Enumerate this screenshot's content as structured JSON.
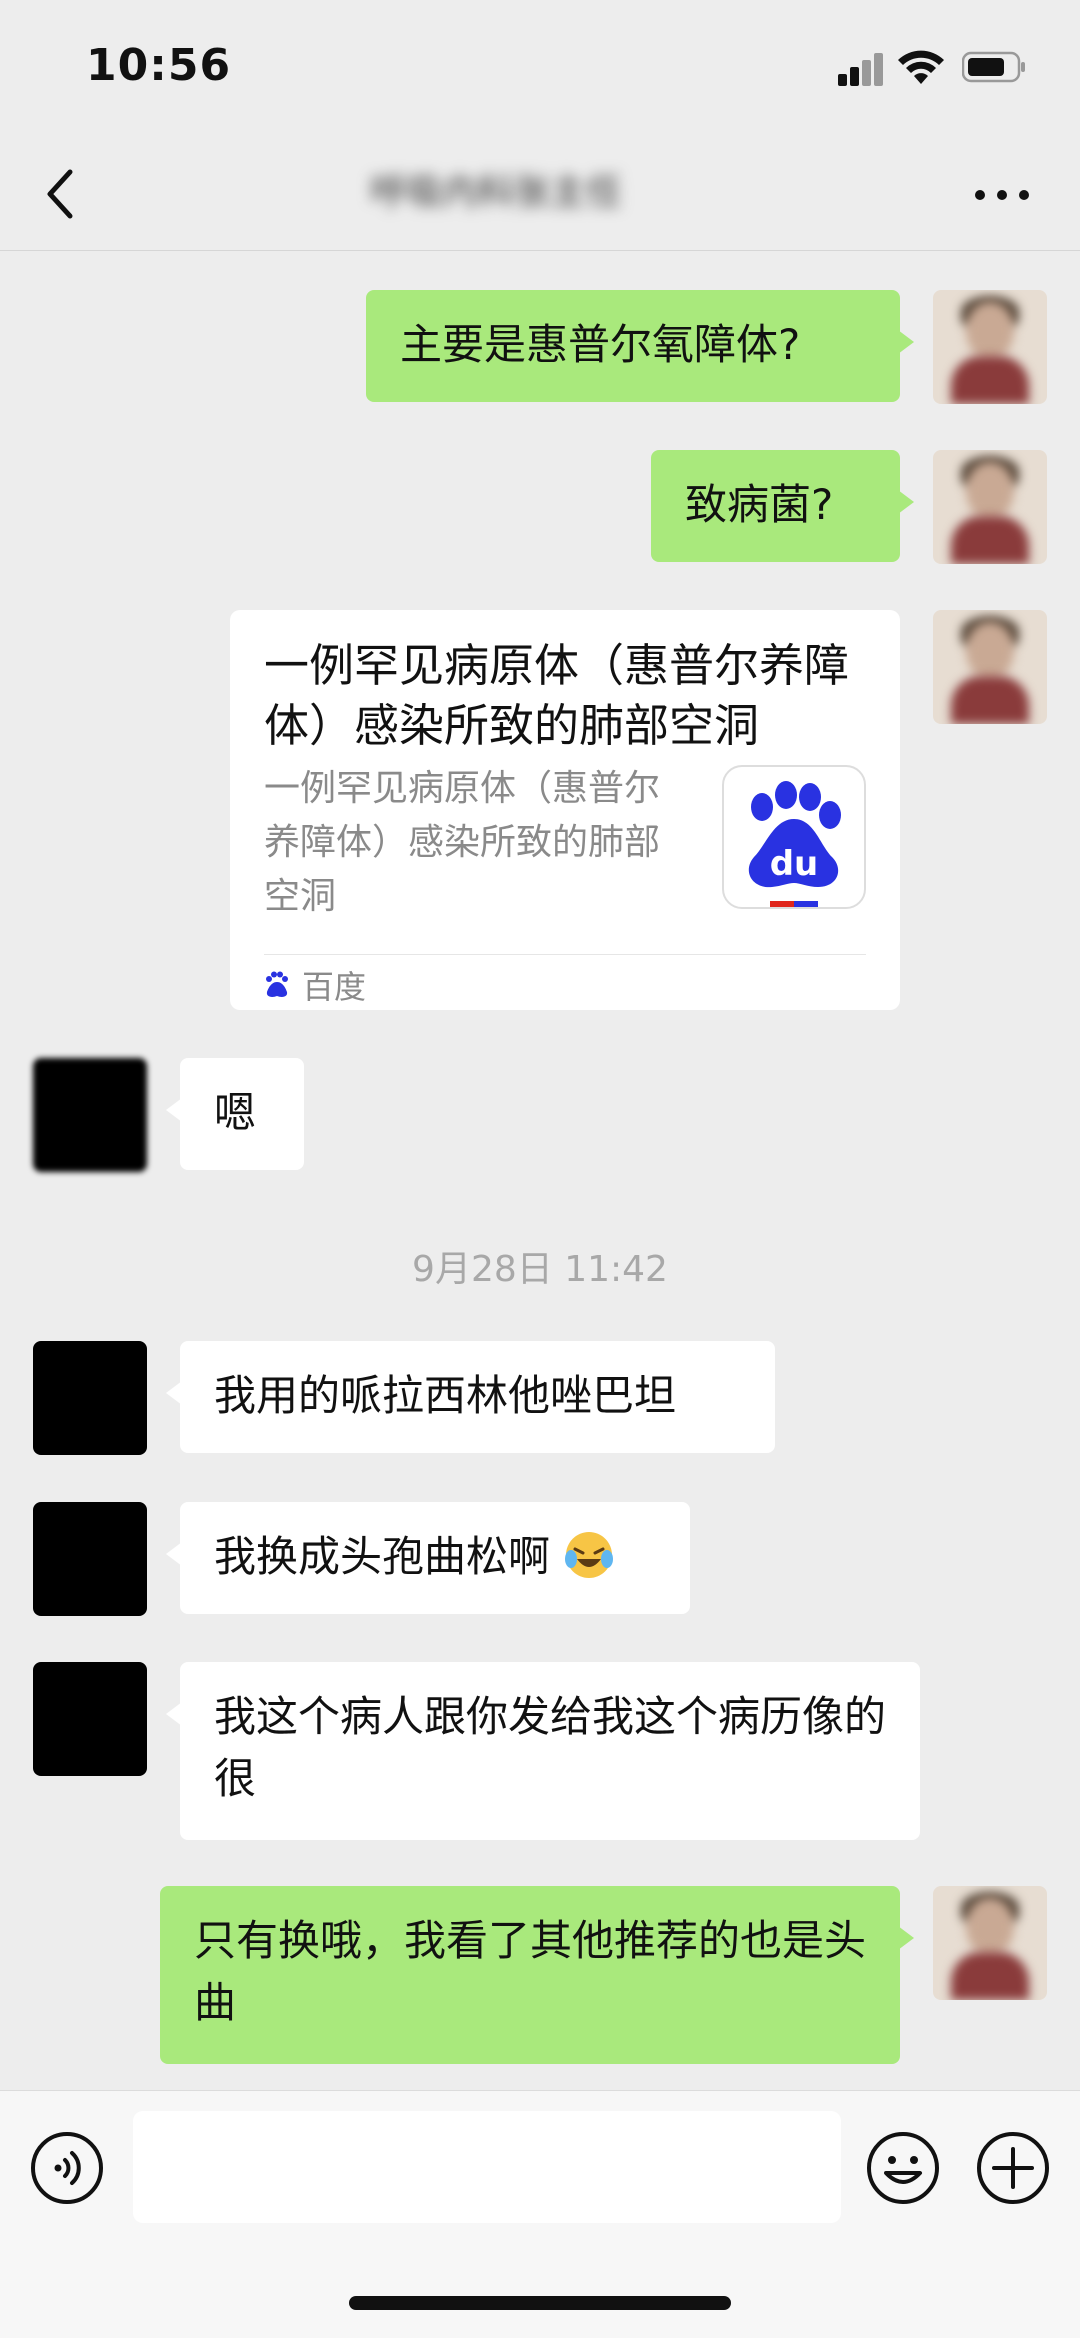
{
  "status_bar": {
    "time": "10:56"
  },
  "header": {
    "title": "呼吸内科张主任",
    "back_icon": "chevron-left-icon",
    "more_icon": "more-dots-icon"
  },
  "messages": [
    {
      "from": "me",
      "text": "主要是惠普尔氧障体?"
    },
    {
      "from": "me",
      "text": "致病菌?"
    },
    {
      "from": "me",
      "type": "link",
      "title": "一例罕见病原体（惠普尔养障体）感染所致的肺部空洞",
      "description": "一例罕见病原体（惠普尔养障体）感染所致的肺部空洞",
      "thumb_text": "du",
      "source": "百度"
    },
    {
      "from": "other",
      "text": "嗯"
    },
    {
      "from": "other",
      "text": "我用的哌拉西林他唑巴坦"
    },
    {
      "from": "other",
      "text": "我换成头孢曲松啊",
      "emoji": "laughing-tears-icon"
    },
    {
      "from": "other",
      "text": "我这个病人跟你发给我这个病历像的很"
    },
    {
      "from": "me",
      "text": "只有换哦，我看了其他推荐的也是头曲"
    }
  ],
  "timestamp": "9月28日 11:42",
  "input": {
    "value": "",
    "placeholder": ""
  },
  "colors": {
    "background": "#ededed",
    "my_bubble": "#a9e97c",
    "other_bubble": "#ffffff",
    "baidu_blue": "#2932e1"
  }
}
